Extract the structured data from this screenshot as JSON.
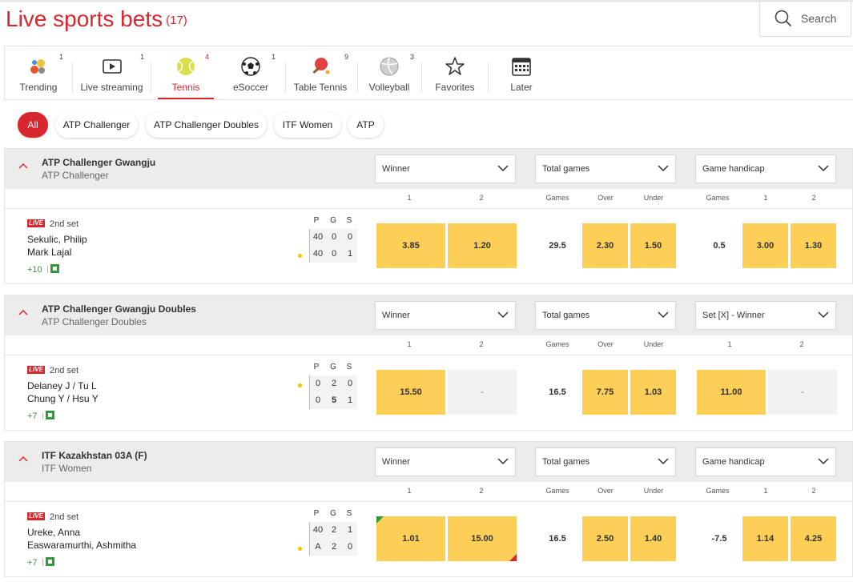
{
  "header": {
    "title": "Live sports bets",
    "count": "(17)",
    "search_label": "Search"
  },
  "categories": [
    {
      "label": "Trending",
      "count": "1",
      "icon": "trending-icon"
    },
    {
      "label": "Live streaming",
      "count": "1",
      "icon": "play-icon"
    },
    {
      "label": "Tennis",
      "count": "4",
      "icon": "tennis-ball-icon",
      "active": true
    },
    {
      "label": "eSoccer",
      "count": "1",
      "icon": "soccer-ball-icon"
    },
    {
      "label": "Table Tennis",
      "count": "9",
      "icon": "table-tennis-icon"
    },
    {
      "label": "Volleyball",
      "count": "3",
      "icon": "volleyball-icon"
    },
    {
      "label": "Favorites",
      "count": "",
      "icon": "star-icon"
    },
    {
      "label": "Later",
      "count": "",
      "icon": "calendar-icon"
    }
  ],
  "filters": [
    "All",
    "ATP Challenger",
    "ATP Challenger Doubles",
    "ITF Women",
    "ATP"
  ],
  "score_headers": [
    "P",
    "G",
    "S"
  ],
  "leagues": [
    {
      "name": "ATP Challenger Gwangju",
      "sub": "ATP Challenger",
      "markets": [
        "Winner",
        "Total games",
        "Game handicap"
      ],
      "col_headers": [
        "1",
        "2",
        "Games",
        "Over",
        "Under",
        "Games",
        "1",
        "2"
      ],
      "event": {
        "live": "LIVE",
        "status": "2nd set",
        "player1": "Sekulic, Philip",
        "player2": "Mark Lajal",
        "more": "+10",
        "score1": [
          "40",
          "0",
          "0"
        ],
        "score2": [
          "40",
          "0",
          "1"
        ],
        "odds_winner": [
          "3.85",
          "1.20"
        ],
        "total_line": "29.5",
        "odds_total": [
          "2.30",
          "1.50"
        ],
        "handicap_line": "0.5",
        "odds_handicap": [
          "3.00",
          "1.30"
        ]
      }
    },
    {
      "name": "ATP Challenger Gwangju Doubles",
      "sub": "ATP Challenger Doubles",
      "markets": [
        "Winner",
        "Total games",
        "Set [X] - Winner"
      ],
      "col_headers": [
        "1",
        "2",
        "Games",
        "Over",
        "Under",
        "1",
        "2"
      ],
      "event": {
        "live": "LIVE",
        "status": "2nd set",
        "player1": "Delaney J / Tu L",
        "player2": "Chung Y / Hsu Y",
        "more": "+7",
        "score1": [
          "0",
          "2",
          "0"
        ],
        "score2": [
          "0",
          "5",
          "1"
        ],
        "odds_winner": [
          "15.50",
          "-"
        ],
        "total_line": "16.5",
        "odds_total": [
          "7.75",
          "1.03"
        ],
        "odds_set": [
          "11.00",
          "-"
        ]
      }
    },
    {
      "name": "ITF Kazakhstan 03A (F)",
      "sub": "ITF Women",
      "markets": [
        "Winner",
        "Total games",
        "Game handicap"
      ],
      "col_headers": [
        "1",
        "2",
        "Games",
        "Over",
        "Under",
        "Games",
        "1",
        "2"
      ],
      "event": {
        "live": "LIVE",
        "status": "2nd set",
        "player1": "Ureke, Anna",
        "player2": "Easwaramurthi, Ashmitha",
        "more": "+7",
        "score1": [
          "40",
          "2",
          "1"
        ],
        "score2": [
          "A",
          "2",
          "0"
        ],
        "odds_winner": [
          "1.01",
          "15.00"
        ],
        "total_line": "16.5",
        "odds_total": [
          "2.50",
          "1.40"
        ],
        "handicap_line": "-7.5",
        "odds_handicap": [
          "1.14",
          "4.25"
        ]
      }
    }
  ],
  "colors": {
    "brand_red": "#d8262e",
    "odds_yellow": "#fdcf57",
    "header_grey": "#ececec"
  }
}
